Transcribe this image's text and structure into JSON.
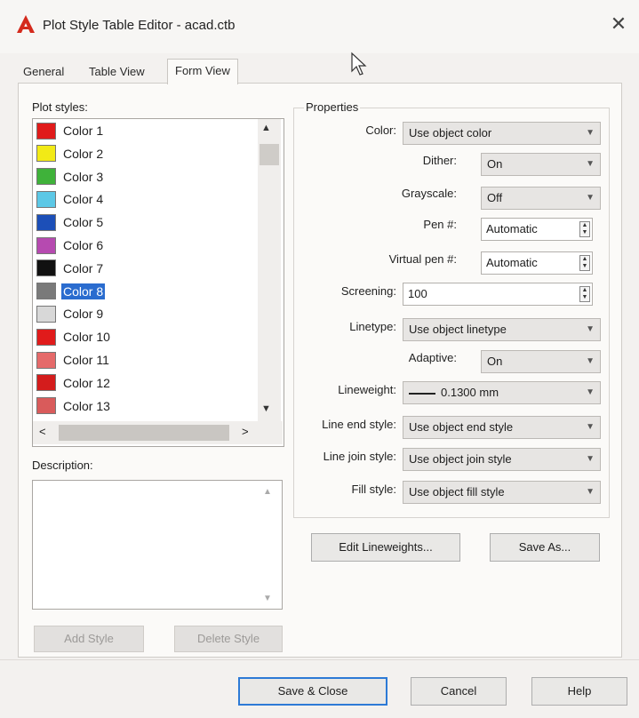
{
  "window": {
    "title": "Plot Style Table Editor - acad.ctb",
    "close_symbol": "✕"
  },
  "tabs": [
    {
      "label": "General"
    },
    {
      "label": "Table View"
    },
    {
      "label": "Form View",
      "active": true
    }
  ],
  "plot_styles": {
    "label": "Plot styles:",
    "items": [
      {
        "label": "Color 1",
        "color": "#e01b1b"
      },
      {
        "label": "Color 2",
        "color": "#f2ea16"
      },
      {
        "label": "Color 3",
        "color": "#3fb23a"
      },
      {
        "label": "Color 4",
        "color": "#5cc8e6"
      },
      {
        "label": "Color 5",
        "color": "#1c4fb8"
      },
      {
        "label": "Color 6",
        "color": "#b64ab0"
      },
      {
        "label": "Color 7",
        "color": "#111111"
      },
      {
        "label": "Color 8",
        "color": "#7a7a7a",
        "selected": true
      },
      {
        "label": "Color 9",
        "color": "#d8d8d8"
      },
      {
        "label": "Color 10",
        "color": "#e01b1b"
      },
      {
        "label": "Color 11",
        "color": "#e56a6a"
      },
      {
        "label": "Color 12",
        "color": "#d41c1c"
      },
      {
        "label": "Color 13",
        "color": "#d95b5b"
      }
    ],
    "scroll_up": "▲",
    "scroll_down": "▼",
    "scroll_left": "<",
    "scroll_right": ">"
  },
  "description": {
    "label": "Description:"
  },
  "buttons": {
    "add_style": "Add Style",
    "delete_style": "Delete Style",
    "edit_lineweights": "Edit Lineweights...",
    "save_as": "Save As...",
    "save_close": "Save & Close",
    "cancel": "Cancel",
    "help": "Help"
  },
  "properties": {
    "label": "Properties",
    "color": {
      "label": "Color:",
      "value": "Use object color"
    },
    "dither": {
      "label": "Dither:",
      "value": "On"
    },
    "grayscale": {
      "label": "Grayscale:",
      "value": "Off"
    },
    "pen": {
      "label": "Pen #:",
      "value": "Automatic"
    },
    "virtual_pen": {
      "label": "Virtual pen #:",
      "value": "Automatic"
    },
    "screening": {
      "label": "Screening:",
      "value": "100"
    },
    "linetype": {
      "label": "Linetype:",
      "value": "Use object linetype"
    },
    "adaptive": {
      "label": "Adaptive:",
      "value": "On"
    },
    "lineweight": {
      "label": "Lineweight:",
      "value": "0.1300 mm"
    },
    "line_end": {
      "label": "Line end style:",
      "value": "Use object end style"
    },
    "line_join": {
      "label": "Line join style:",
      "value": "Use object join style"
    },
    "fill": {
      "label": "Fill style:",
      "value": "Use object fill style"
    }
  },
  "colors": {
    "accent": "#2d7ad6",
    "selection": "#2a6ccf",
    "logo_red": "#d42a1c"
  }
}
